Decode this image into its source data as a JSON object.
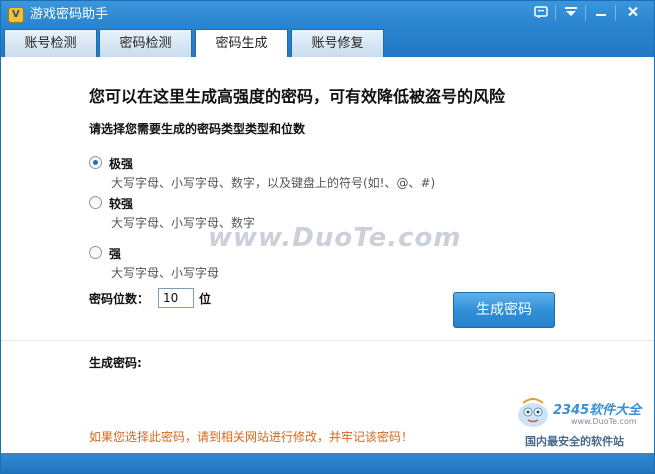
{
  "window": {
    "title": "游戏密码助手",
    "colors": {
      "titlebar": "#2b85d0",
      "accent": "#2f8ed8",
      "warning": "#d2691e"
    }
  },
  "tabs": [
    {
      "label": "账号检测",
      "active": false
    },
    {
      "label": "密码检测",
      "active": false
    },
    {
      "label": "密码生成",
      "active": true
    },
    {
      "label": "账号修复",
      "active": false
    }
  ],
  "main": {
    "headline": "您可以在这里生成高强度的密码，可有效降低被盗号的风险",
    "subtitle": "请选择您需要生成的密码类型类型和位数",
    "options": [
      {
        "label": "极强",
        "desc": "大写字母、小写字母、数字，以及键盘上的符号(如!、@、#)",
        "selected": true
      },
      {
        "label": "较强",
        "desc": "大写字母、小写字母、数字",
        "selected": false
      },
      {
        "label": "强",
        "desc": "大写字母、小写字母",
        "selected": false
      }
    ],
    "length_label": "密码位数：",
    "length_value": "10",
    "length_unit": "位",
    "generate_button": "生成密码",
    "output_label": "生成密码:",
    "warning": "如果您选择此密码，请到相关网站进行修改，并牢记该密码！"
  },
  "watermarks": {
    "center": "www.DuoTe.com",
    "brand": "2345软件大全",
    "url": "www.DuoTe.com",
    "slogan": "国内最安全的软件站"
  },
  "icons": [
    "app-logo-icon",
    "feedback-icon",
    "menu-dropdown-icon",
    "minimize-icon",
    "close-icon"
  ]
}
